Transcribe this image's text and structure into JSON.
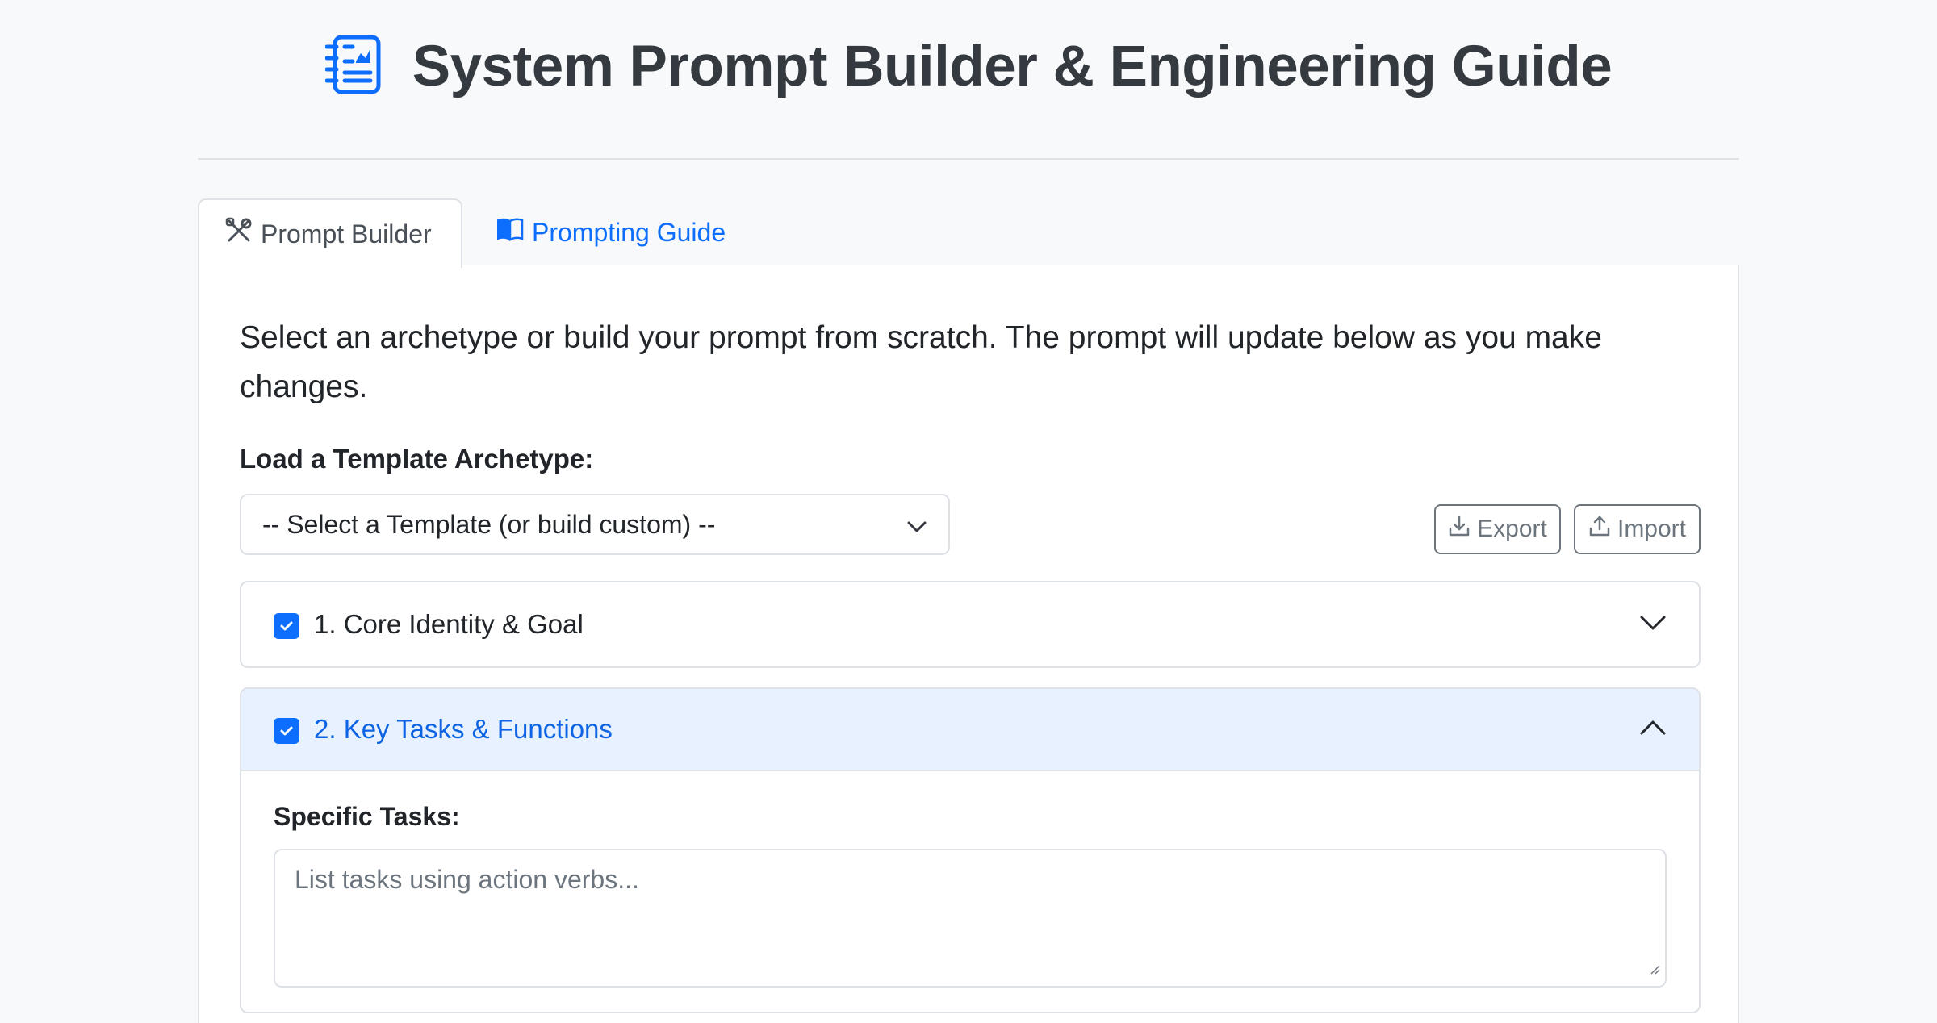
{
  "header": {
    "title": "System Prompt Builder & Engineering Guide",
    "icon": "document-list-icon",
    "icon_color": "#0d6efd"
  },
  "tabs": [
    {
      "label": "Prompt Builder",
      "icon": "tools-icon",
      "active": true
    },
    {
      "label": "Prompting Guide",
      "icon": "book-icon",
      "active": false
    }
  ],
  "builder": {
    "intro": "Select an archetype or build your prompt from scratch. The prompt will update below as you make changes.",
    "template_label": "Load a Template Archetype:",
    "template_select": {
      "selected": "-- Select a Template (or build custom) --"
    },
    "export_label": "Export",
    "import_label": "Import",
    "sections": [
      {
        "label": "1. Core Identity & Goal",
        "checked": true,
        "expanded": false
      },
      {
        "label": "2. Key Tasks & Functions",
        "checked": true,
        "expanded": true,
        "fields": {
          "tasks_label": "Specific Tasks:",
          "tasks_placeholder": "List tasks using action verbs..."
        }
      }
    ]
  },
  "colors": {
    "accent": "#0d6efd",
    "active_section_bg": "#e7f1ff",
    "border": "#dee2e6",
    "page_bg": "#f8f9fa"
  }
}
